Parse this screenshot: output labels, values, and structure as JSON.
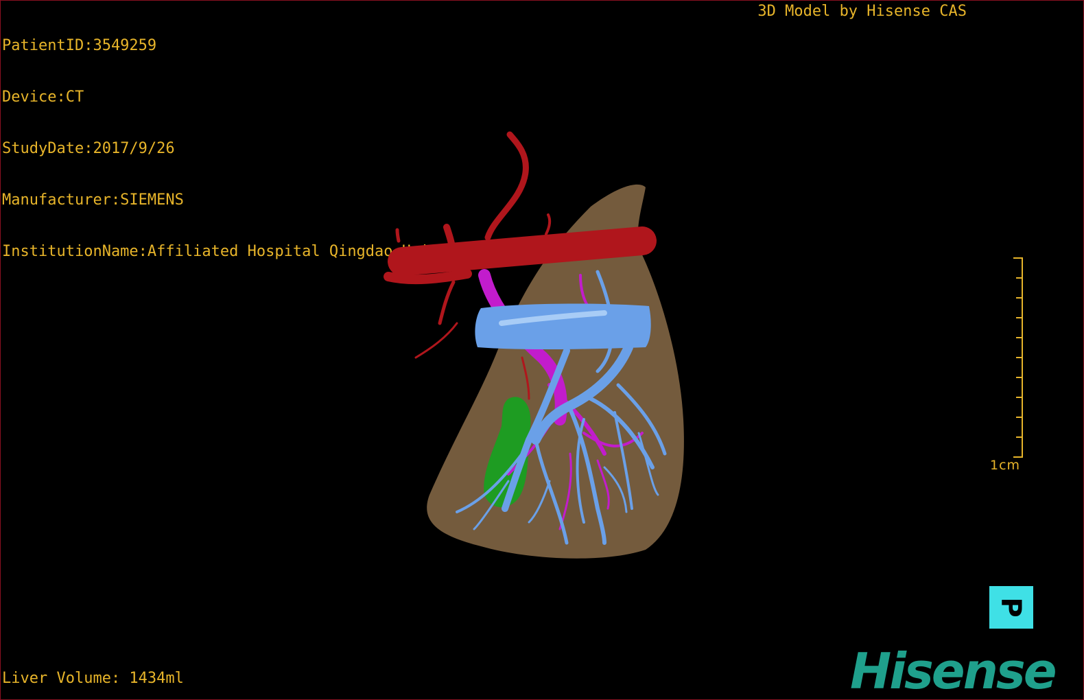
{
  "patient_info": {
    "patient_id": "PatientID:3549259",
    "device": "Device:CT",
    "study_date": "StudyDate:2017/9/26",
    "manufacturer": "Manufacturer:SIEMENS",
    "institution": "InstitutionName:Affiliated Hospital Qingdao University-C"
  },
  "credit": "3D Model by Hisense CAS",
  "liver_volume": "Liver Volume: 1434ml",
  "scale_bar": {
    "label": "1cm"
  },
  "orientation_marker": {
    "label": "P"
  },
  "logo": "Hisense",
  "colors": {
    "overlay_text": "#e8b52a",
    "liver": "#7a6040",
    "artery": "#b0161c",
    "portal_vein": "#6aa0e8",
    "hepatic_vein": "#c21ccc",
    "gallbladder": "#1e9c22",
    "orientation_cube": "#3fe0e6",
    "logo": "#1fa08c",
    "border": "#8a1020"
  }
}
